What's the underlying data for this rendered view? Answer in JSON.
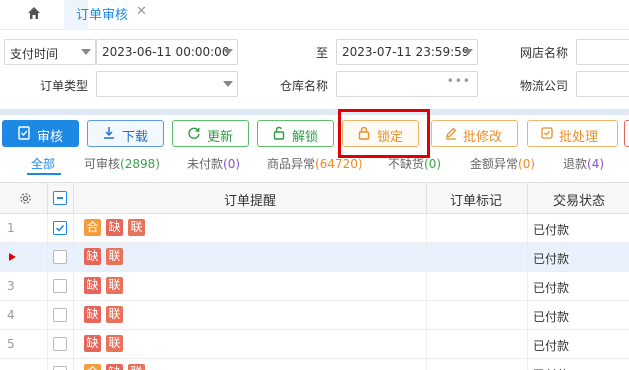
{
  "tabs": {
    "active_label": "订单审核",
    "close_glyph": "✕"
  },
  "filters": {
    "pay_time_select": "支付时间",
    "start_time": "2023-06-11 00:00:00",
    "to_label": "至",
    "end_time": "2023-07-11 23:59:59",
    "shop_label": "网店名称",
    "order_type_label": "订单类型",
    "warehouse_label": "仓库名称",
    "logistics_label": "物流公司",
    "more_glyph": "•••"
  },
  "toolbar": {
    "audit": "审核",
    "download": "下载",
    "refresh": "更新",
    "unlock": "解锁",
    "lock": "锁定",
    "batch_edit": "批修改",
    "batch_process": "批处理"
  },
  "status_tabs": [
    {
      "label": "全部",
      "count": ""
    },
    {
      "label": "可审核",
      "count": "(2898)"
    },
    {
      "label": "未付款",
      "count": "(0)"
    },
    {
      "label": "商品异常",
      "count": "(64720)"
    },
    {
      "label": "不缺货",
      "count": "(0)"
    },
    {
      "label": "金额异常",
      "count": "(0)"
    },
    {
      "label": "退款",
      "count": "(4)"
    }
  ],
  "grid": {
    "headers": {
      "reminder": "订单提醒",
      "mark": "订单标记",
      "trade_status": "交易状态"
    },
    "rows": [
      {
        "num": "1",
        "checked": true,
        "tags": [
          "合",
          "缺",
          "联"
        ],
        "status": "已付款"
      },
      {
        "num": "",
        "current": true,
        "tags": [
          "缺",
          "联"
        ],
        "status": "已付款"
      },
      {
        "num": "3",
        "tags": [
          "缺",
          "联"
        ],
        "status": "已付款"
      },
      {
        "num": "4",
        "tags": [
          "缺",
          "联"
        ],
        "status": "已付款"
      },
      {
        "num": "5",
        "tags": [
          "缺",
          "联"
        ],
        "status": "已付款"
      },
      {
        "num": "",
        "tags": [
          "合",
          "缺",
          "联"
        ],
        "status": "已付款"
      }
    ]
  },
  "colors": {
    "accent": "#1e88e5",
    "highlight_box": "#e00000"
  }
}
